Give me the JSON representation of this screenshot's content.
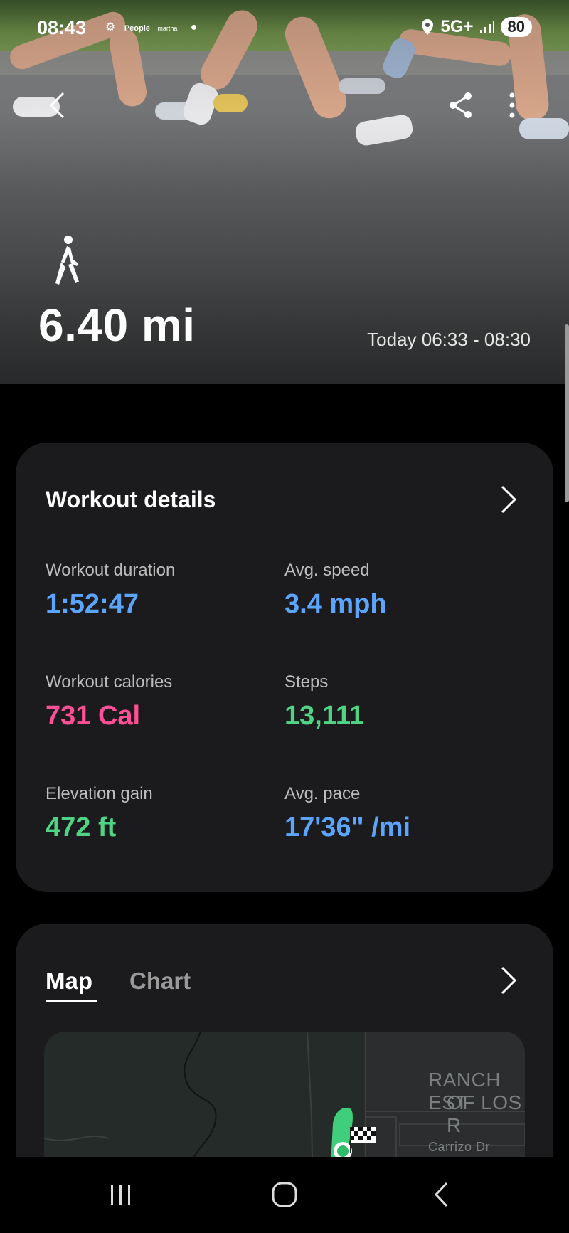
{
  "status_bar": {
    "time": "08:43",
    "notification_icons": [
      "settings-icon",
      "people-app-icon",
      "martha-stewart-app-icon",
      "dot-icon"
    ],
    "network": "5G+",
    "battery": "80"
  },
  "hero": {
    "activity_icon": "walking-icon",
    "distance": "6.40 mi",
    "time_range": "Today 06:33 - 08:30"
  },
  "workout_details": {
    "title": "Workout details",
    "metrics": [
      {
        "label": "Workout duration",
        "value": "1:52:47",
        "color": "#5ca5ff"
      },
      {
        "label": "Avg. speed",
        "value": "3.4 mph",
        "color": "#5ca5ff"
      },
      {
        "label": "Workout calories",
        "value": "731 Cal",
        "color": "#ff4f97"
      },
      {
        "label": "Steps",
        "value": "13,111",
        "color": "#4fd485"
      },
      {
        "label": "Elevation gain",
        "value": "472 ft",
        "color": "#4fd485"
      },
      {
        "label": "Avg. pace",
        "value": "17'36\" /mi",
        "color": "#5ca5ff"
      }
    ]
  },
  "map_card": {
    "tabs": [
      {
        "label": "Map",
        "selected": true
      },
      {
        "label": "Chart",
        "selected": false
      }
    ],
    "map_labels": [
      "RANCH EST",
      "OF LOS R",
      "Carrizo Dr"
    ]
  },
  "colors": {
    "accent_blue": "#5ca5ff",
    "calories_pink": "#ff4f97",
    "steps_green": "#4fd485",
    "card_bg": "#1b1b1d"
  }
}
